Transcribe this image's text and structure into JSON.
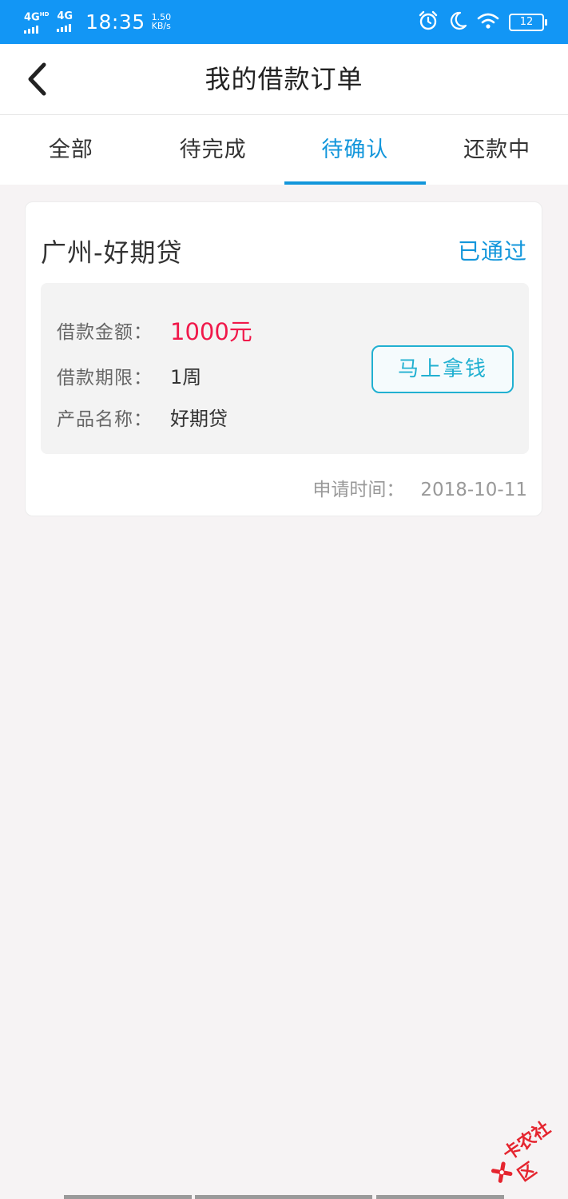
{
  "status_bar": {
    "signal1": "4G",
    "signal1_sup": "HD",
    "signal2": "4G",
    "time": "18:35",
    "speed_value": "1.50",
    "speed_unit": "KB/s",
    "battery": "12",
    "icons": [
      "alarm-icon",
      "moon-icon",
      "wifi-icon",
      "battery-icon"
    ]
  },
  "header": {
    "title": "我的借款订单",
    "back_icon": "chevron-left-icon"
  },
  "tabs": [
    {
      "label": "全部",
      "active": false
    },
    {
      "label": "待完成",
      "active": false
    },
    {
      "label": "待确认",
      "active": true
    },
    {
      "label": "还款中",
      "active": false
    }
  ],
  "order": {
    "title": "广州-好期贷",
    "status": "已通过",
    "amount_label": "借款金额：",
    "amount_value": "1000元",
    "term_label": "借款期限：",
    "term_value": "1周",
    "product_label": "产品名称：",
    "product_value": "好期贷",
    "action_label": "马上拿钱",
    "apply_time_label": "申请时间：",
    "apply_time_value": "2018-10-11"
  },
  "watermark": {
    "text": "卡农社区"
  },
  "colors": {
    "status_bar": "#1296f5",
    "accent": "#1296db",
    "amount": "#f0184a",
    "button": "#21b0d1",
    "background": "#f6f3f4"
  }
}
